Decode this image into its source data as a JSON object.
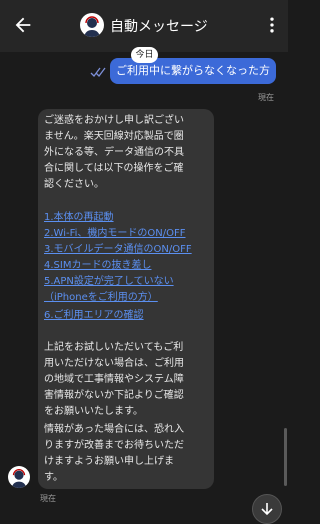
{
  "header": {
    "title": "自動メッセージ",
    "back_icon": "arrow-left-icon",
    "more_icon": "more-vertical-icon"
  },
  "conversation": {
    "date_label": "今日",
    "outgoing": {
      "text": "ご利用中に繋がらなくなった方",
      "time": "現在",
      "read_icon": "double-check-icon"
    },
    "incoming": {
      "intro_lines": [
        "ご迷惑をおかけし申し訳ござい",
        "ません。楽天回線対応製品で圏",
        "外になる等、データ通信の不具",
        "合に関しては以下の操作をご確",
        "認ください。"
      ],
      "items": [
        {
          "label": "1.本体の再起動",
          "link": true
        },
        {
          "label": "2.Wi-Fi、機内モードのON/OFF",
          "link": true
        },
        {
          "label": "3.モバイルデータ通信のON/OFF",
          "link": true
        },
        {
          "label": "4.SIMカードの抜き差し",
          "link": true
        },
        {
          "label": "5.APN設定が完了していない",
          "link": true
        },
        {
          "label": "（iPhoneをご利用の方）",
          "link": true
        },
        {
          "label": "6.ご利用エリアの確認",
          "link": true
        }
      ],
      "outro_lines": [
        "上記をお試しいただいてもご利",
        "用いただけない場合は、ご利用",
        "の地域で工事情報やシステム障",
        "害情報がないか下記よりご確認",
        "をお願いいたします。",
        "情報があった場合には、恐れ入",
        "りますが改善までお待ちいただ",
        "けますようお願い申し上げま",
        "す。"
      ],
      "time": "現在"
    },
    "scroll_down_icon": "arrow-down-icon"
  },
  "colors": {
    "background": "#1b1b1b",
    "appbar": "#262626",
    "outgoing_bubble": "#3c6ad8",
    "incoming_bubble": "#353535",
    "link": "#5b8ff0"
  }
}
